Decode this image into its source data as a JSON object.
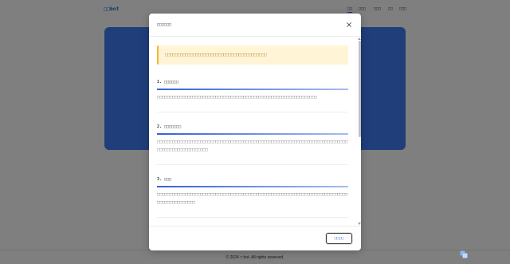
{
  "page": {
    "logo": "□□bot",
    "nav": [
      "□□",
      "□□□",
      "□□□",
      "□□",
      "□□□"
    ],
    "footer": "© 2024 □ bot. All rights reserved."
  },
  "modal": {
    "title": "□□□□□□",
    "notice": "□□□□□□□□□□□□□□□□□□□□□□□□□□□□□□□□□□□□□□□□",
    "sections": [
      {
        "heading": "1. □□□□□□",
        "body": "□□□□□□□□□□□□□□□□□□□□□□□□□□□□□□□□□□□□□□□□□□□□□□□□□□□□□□□□□□□□□□□"
      },
      {
        "heading": "2. □□□□□□□",
        "body": "□□□□□□□□□□□□□□□□□□□□□□□□□□□□□□□□□□□□□□□□□□□□□□□□□□□□□□□□□□□□□□□□□□□□□□□□□□□□□□□□□□□□□□□□□□□□□□□"
      },
      {
        "heading": "3. □□□",
        "body": "□□□□□□□□□□□□□□□□□□□□□□□□□□□□□□□□□□□□□□□□□□□□□□□□□□□□□□□□□□□□□□□□□□□□□□□□□□□□□□□□□□□□□□□□□□"
      }
    ],
    "confirm_label": "□□□□"
  },
  "colors": {
    "accent": "#2f62e6",
    "hero": "#3f7cf4",
    "notice_bg": "#fff5d6",
    "notice_border": "#f2b731",
    "notice_text": "#b98c35"
  },
  "icons": {
    "close": "close-icon",
    "widget": "floating-widget-icon",
    "scroll_up": "scroll-up-arrow-icon",
    "scroll_down": "scroll-down-arrow-icon"
  }
}
